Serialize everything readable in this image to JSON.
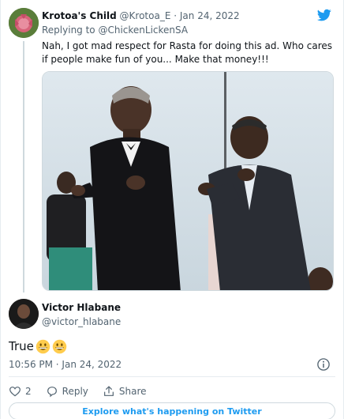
{
  "reply_tweet": {
    "display_name": "Krotoa's Child",
    "handle": "@Krotoa_E",
    "separator": "·",
    "date": "Jan 24, 2022",
    "replying_to_prefix": "Replying to",
    "replying_to_handle": "@ChickenLickenSA",
    "text": "Nah, I got mad respect for Rasta for doing this ad. Who cares if people make fun of you... Make that money!!!"
  },
  "main_tweet": {
    "display_name": "Victor Hlabane",
    "handle": "@victor_hlabane",
    "text": "True",
    "emoji_count": 2,
    "timestamp": "10:56 PM · Jan 24, 2022"
  },
  "actions": {
    "like_count": "2",
    "reply_label": "Reply",
    "share_label": "Share"
  },
  "footer": {
    "explore_label": "Explore what's happening on Twitter"
  },
  "colors": {
    "accent": "#1d9bf0",
    "muted_text": "#536471",
    "border": "#cfd9de"
  },
  "icons": [
    "twitter-bird-icon",
    "info-icon",
    "heart-icon",
    "reply-icon",
    "share-icon",
    "grinning-emoji-icon"
  ]
}
